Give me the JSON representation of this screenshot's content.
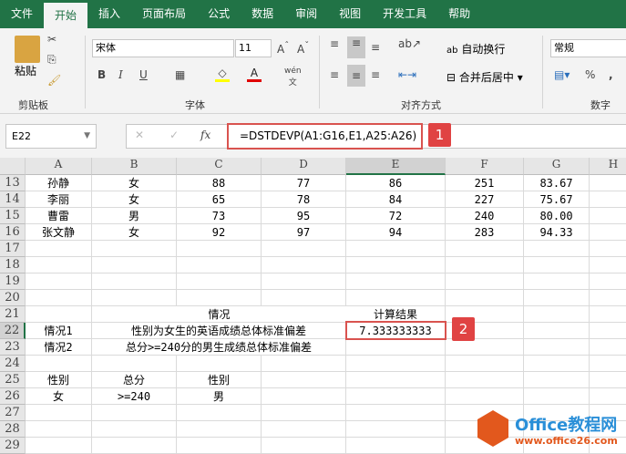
{
  "tabs": [
    "文件",
    "开始",
    "插入",
    "页面布局",
    "公式",
    "数据",
    "审阅",
    "视图",
    "开发工具",
    "帮助"
  ],
  "ribbon": {
    "paste": "粘贴",
    "clipboard": "剪贴板",
    "font_name": "宋体",
    "font_size": "11",
    "font_group": "字体",
    "bold": "B",
    "italic": "I",
    "underline": "U",
    "wrap": "自动换行",
    "merge": "合并后居中",
    "align_group": "对齐方式",
    "number_format": "常规",
    "number_group": "数字",
    "percent": "%",
    "comma": ","
  },
  "formula_bar": {
    "name_box": "E22",
    "fx": "fx",
    "formula": "=DSTDEVP(A1:G16,E1,A25:A26)",
    "badge": "1"
  },
  "columns": [
    "A",
    "B",
    "C",
    "D",
    "E",
    "F",
    "G",
    "H"
  ],
  "rows": [
    {
      "n": "13",
      "c": [
        "孙静",
        "女",
        "88",
        "77",
        "86",
        "251",
        "83.67"
      ]
    },
    {
      "n": "14",
      "c": [
        "李丽",
        "女",
        "65",
        "78",
        "84",
        "227",
        "75.67"
      ]
    },
    {
      "n": "15",
      "c": [
        "曹雷",
        "男",
        "73",
        "95",
        "72",
        "240",
        "80.00"
      ]
    },
    {
      "n": "16",
      "c": [
        "张文静",
        "女",
        "92",
        "97",
        "94",
        "283",
        "94.33"
      ]
    },
    {
      "n": "17",
      "c": [
        "",
        "",
        "",
        "",
        "",
        "",
        ""
      ]
    },
    {
      "n": "18",
      "c": [
        "",
        "",
        "",
        "",
        "",
        "",
        ""
      ]
    },
    {
      "n": "19",
      "c": [
        "",
        "",
        "",
        "",
        "",
        "",
        ""
      ]
    },
    {
      "n": "20",
      "c": [
        "",
        "",
        "",
        "",
        "",
        "",
        ""
      ]
    },
    {
      "n": "21",
      "c": [
        "",
        "",
        "情况",
        "",
        "计算结果",
        "",
        ""
      ]
    },
    {
      "n": "22",
      "c": [
        "情况1",
        "",
        "",
        "",
        "7.333333333",
        "",
        ""
      ]
    },
    {
      "n": "23",
      "c": [
        "情况2",
        "",
        "",
        "",
        "",
        "",
        ""
      ]
    },
    {
      "n": "24",
      "c": [
        "",
        "",
        "",
        "",
        "",
        "",
        ""
      ]
    },
    {
      "n": "25",
      "c": [
        "性别",
        "总分",
        "性别",
        "",
        "",
        "",
        ""
      ]
    },
    {
      "n": "26",
      "c": [
        "女",
        ">=240",
        "男",
        "",
        "",
        "",
        ""
      ]
    },
    {
      "n": "27",
      "c": [
        "",
        "",
        "",
        "",
        "",
        "",
        ""
      ]
    },
    {
      "n": "28",
      "c": [
        "",
        "",
        "",
        "",
        "",
        "",
        ""
      ]
    },
    {
      "n": "29",
      "c": [
        "",
        "",
        "",
        "",
        "",
        "",
        ""
      ]
    }
  ],
  "merged": {
    "r22": "性别为女生的英语成绩总体标准偏差",
    "r23": "总分>=240分的男生成绩总体标准偏差"
  },
  "result_badge": "2",
  "watermark": {
    "title": "Office教程网",
    "url": "www.office26.com"
  }
}
